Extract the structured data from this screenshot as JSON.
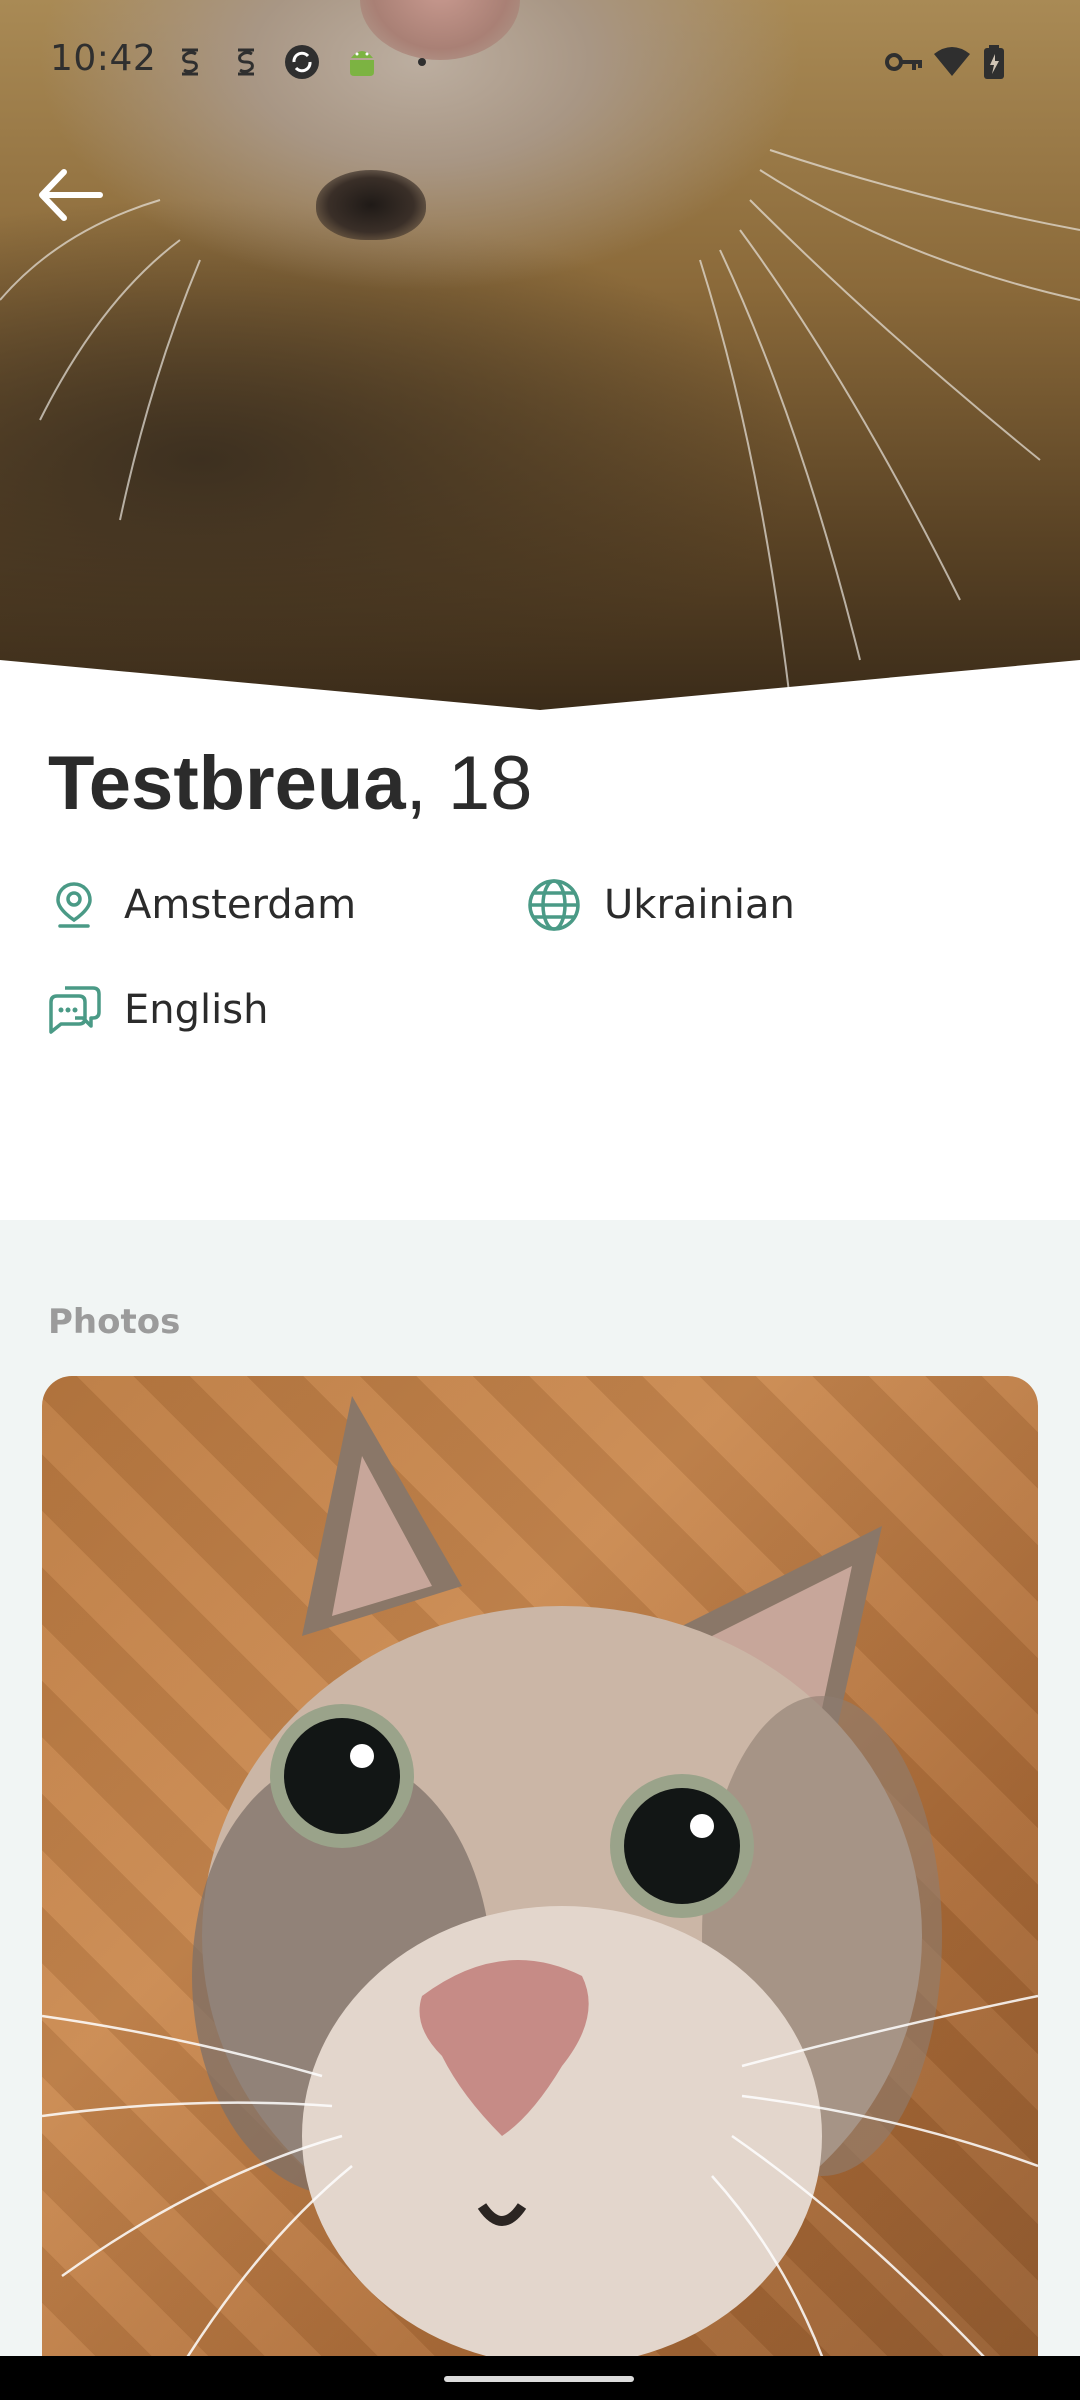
{
  "status_bar": {
    "time": "10:42",
    "icons": [
      "sim-s-icon",
      "sim-s-icon",
      "sync-icon",
      "android-icon",
      "dot-icon",
      "vpn-key-icon",
      "wifi-icon",
      "battery-icon"
    ]
  },
  "header": {
    "back_icon": "arrow-left-icon"
  },
  "profile": {
    "name": "Testbreua",
    "age": ", 18",
    "location": "Amsterdam",
    "nationality": "Ukrainian",
    "language": "English",
    "icons": {
      "location": "map-pin-icon",
      "nationality": "globe-icon",
      "language": "chat-bubbles-icon"
    }
  },
  "photos": {
    "title": "Photos",
    "items": [
      {
        "subject": "cat"
      }
    ]
  },
  "colors": {
    "accent": "#4a9a86",
    "text": "#2b2b2b",
    "muted": "#9b9b9b",
    "section_bg": "#f1f5f4"
  }
}
